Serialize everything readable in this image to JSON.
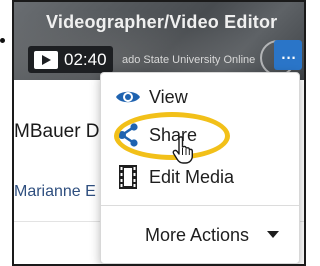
{
  "video": {
    "title": "Videographer/Video Editor",
    "duration": "02:40",
    "source_text": "ado State University Online"
  },
  "list": {
    "creator_partial": "MBauer D",
    "author_partial": "Marianne E"
  },
  "menu": {
    "items": [
      {
        "label": "View",
        "icon": "eye-icon"
      },
      {
        "label": "Share",
        "icon": "share-icon"
      },
      {
        "label": "Edit Media",
        "icon": "film-icon"
      }
    ],
    "more_actions_label": "More Actions"
  },
  "colors": {
    "accent": "#2a75c8",
    "highlight": "#f2c019"
  }
}
